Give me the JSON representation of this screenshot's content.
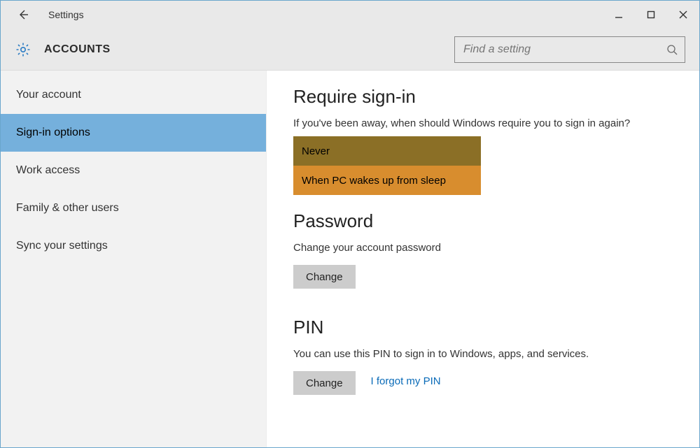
{
  "window": {
    "title": "Settings"
  },
  "header": {
    "page_title": "ACCOUNTS",
    "search_placeholder": "Find a setting"
  },
  "sidebar": {
    "items": [
      {
        "label": "Your account",
        "selected": false
      },
      {
        "label": "Sign-in options",
        "selected": true
      },
      {
        "label": "Work access",
        "selected": false
      },
      {
        "label": "Family & other users",
        "selected": false
      },
      {
        "label": "Sync your settings",
        "selected": false
      }
    ]
  },
  "content": {
    "require_signin": {
      "heading": "Require sign-in",
      "description": "If you've been away, when should Windows require you to sign in again?",
      "options": [
        {
          "label": "Never",
          "state": "selected"
        },
        {
          "label": "When PC wakes up from sleep",
          "state": "hover"
        }
      ]
    },
    "password": {
      "heading": "Password",
      "description": "Change your account password",
      "change_label": "Change"
    },
    "pin": {
      "heading": "PIN",
      "description": "You can use this PIN to sign in to Windows, apps, and services.",
      "change_label": "Change",
      "forgot_link": "I forgot my PIN"
    }
  }
}
